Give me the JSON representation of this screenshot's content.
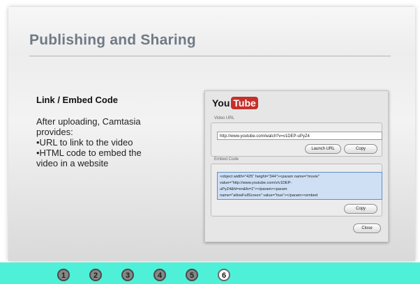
{
  "slide": {
    "title": "Publishing and Sharing",
    "heading": "Link / Embed Code",
    "body_lines": [
      "After uploading, Camtasia",
      "provides:",
      "•URL to link to the video",
      "•HTML code to embed the",
      "video in a website"
    ]
  },
  "dialog": {
    "logo_you": "You",
    "logo_tube": "Tube",
    "video_url_label": "Video URL",
    "video_url_value": "http://www.youtube.com/watch?v=v1DEP-uPyZ4",
    "launch_url_label": "Launch URL",
    "copy_label": "Copy",
    "embed_label": "Embed Code",
    "embed_lines": [
      "<object width=\"425\" height=\"344\"><param name=\"movie\"",
      "value=\"http://www.youtube.com/v/v1DEP-",
      "uPyZ4&hl=en&fs=1\"></param><param",
      "name=\"allowFullScreen\" value=\"true\"></param><embed"
    ],
    "embed_copy_label": "Copy",
    "close_label": "Close"
  },
  "nav": {
    "buttons": [
      "1",
      "2",
      "3",
      "4",
      "5",
      "6"
    ],
    "active_index": 5
  },
  "colors": {
    "footer": "#4ff0d8",
    "title": "#6f7a86",
    "youtube_red": "#c4302b"
  }
}
